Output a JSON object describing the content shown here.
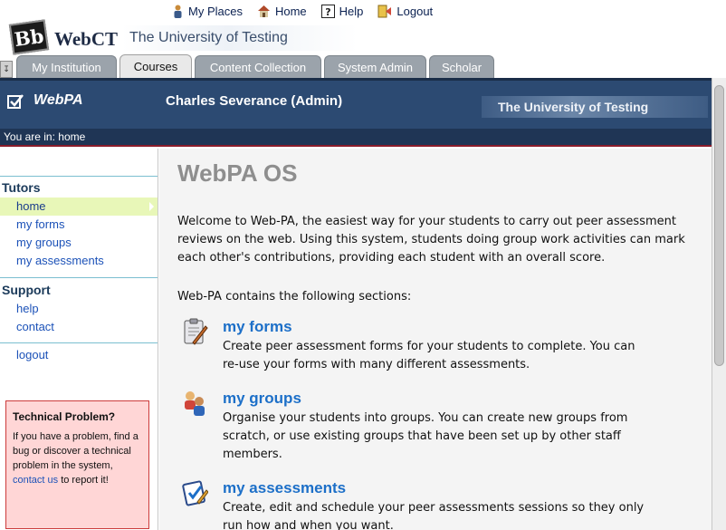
{
  "toplinks": {
    "my_places": "My Places",
    "home": "Home",
    "help": "Help",
    "logout": "Logout"
  },
  "brand": {
    "logo_text": "WebCT",
    "bb_mark": "Bb",
    "university": "The University of Testing"
  },
  "tabs": [
    {
      "label": "My Institution"
    },
    {
      "label": "Courses"
    },
    {
      "label": "Content Collection"
    },
    {
      "label": "System Admin"
    },
    {
      "label": "Scholar"
    }
  ],
  "band": {
    "app_name": "WebPA",
    "user": "Charles Severance (Admin)",
    "university": "The University of Testing"
  },
  "breadcrumb": "You are in: home",
  "sidebar": {
    "tutors_heading": "Tutors",
    "tutor_links": [
      {
        "label": "home"
      },
      {
        "label": "my forms"
      },
      {
        "label": "my groups"
      },
      {
        "label": "my assessments"
      }
    ],
    "support_heading": "Support",
    "support_links": [
      {
        "label": "help"
      },
      {
        "label": "contact"
      }
    ],
    "logout": "logout",
    "tech": {
      "title": "Technical Problem?",
      "text_before": "If you have a problem, find a bug or discover a technical problem in the system, ",
      "link": "contact us",
      "text_after": " to report it!"
    }
  },
  "main": {
    "title": "WebPA OS",
    "intro": "Welcome to Web-PA, the easiest way for your students to carry out peer assessment reviews on the web. Using this system, students doing group work activities can mark each other's contributions, providing each student with an overall score.",
    "contains": "Web-PA contains the following sections:",
    "sections": [
      {
        "title": "my forms",
        "desc": "Create peer assessment forms for your students to complete. You can re-use your forms with many different assessments."
      },
      {
        "title": "my groups",
        "desc": "Organise your students into groups. You can create new groups from scratch, or use existing groups that have been set up by other staff members."
      },
      {
        "title": "my assessments",
        "desc": "Create, edit and schedule your peer assessments sessions so they only run how and when you want."
      }
    ]
  },
  "colors": {
    "band": "#2c4a72",
    "link": "#1c52b8",
    "section_title": "#1c6fc8",
    "active_nav": "#e8f7b8",
    "alert_bg": "#ffd6d6",
    "alert_border": "#cc3b3b"
  }
}
